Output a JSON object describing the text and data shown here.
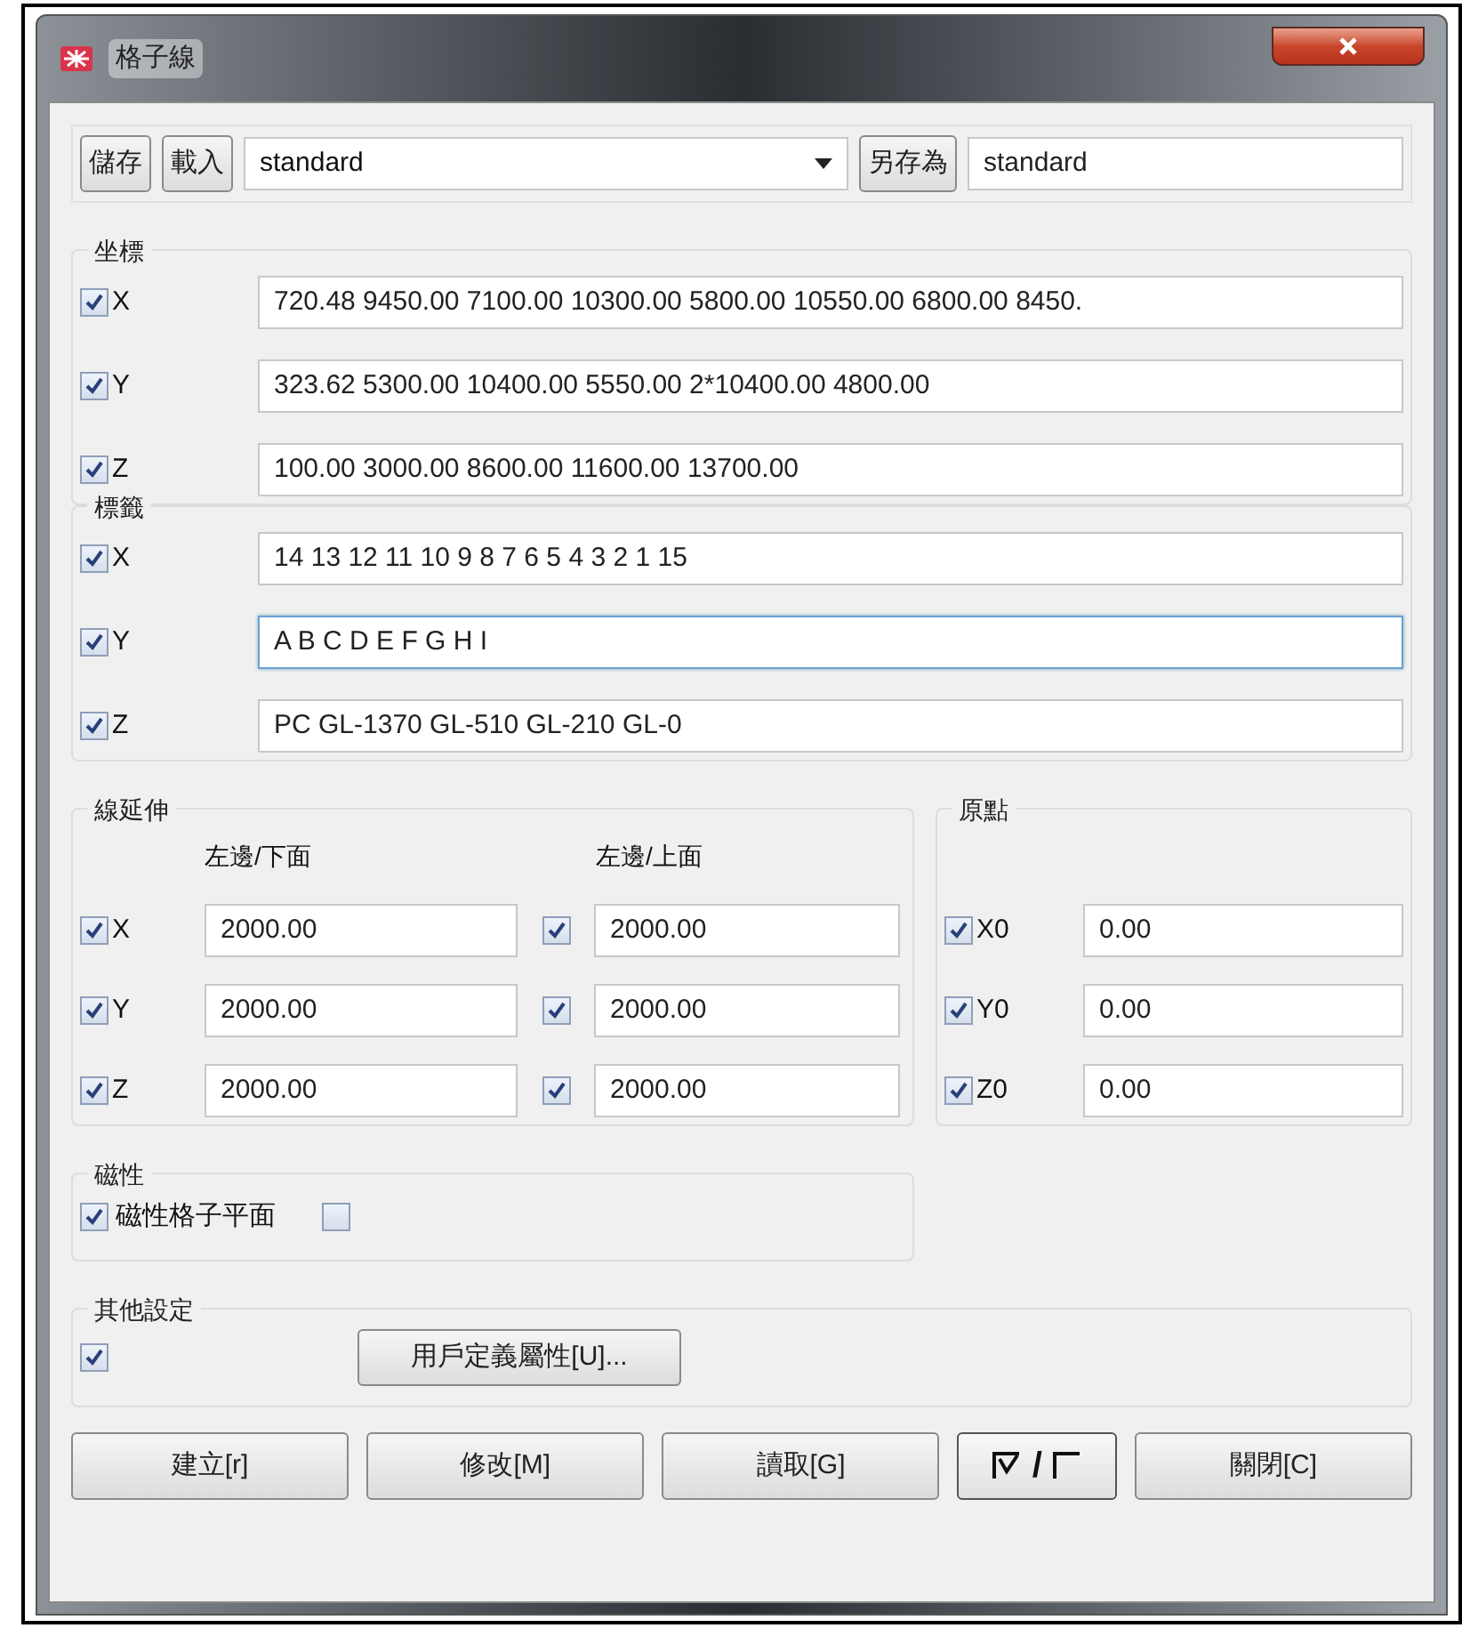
{
  "window": {
    "title": "格子線"
  },
  "toolbar": {
    "save": "儲存",
    "load": "載入",
    "preset": "standard",
    "save_as": "另存為",
    "save_as_name": "standard"
  },
  "coordinates": {
    "title": "坐標",
    "rows": [
      {
        "label": "X",
        "checked": true,
        "value": "720.48 9450.00 7100.00 10300.00 5800.00 10550.00 6800.00 8450.",
        "focused": false
      },
      {
        "label": "Y",
        "checked": true,
        "value": "323.62 5300.00 10400.00 5550.00 2*10400.00 4800.00",
        "focused": false
      },
      {
        "label": "Z",
        "checked": true,
        "value": "100.00 3000.00 8600.00 11600.00 13700.00",
        "focused": false
      }
    ]
  },
  "labels": {
    "title": "標籤",
    "rows": [
      {
        "label": "X",
        "checked": true,
        "value": "14 13 12 11 10 9 8 7 6 5 4 3 2 1 15",
        "focused": false
      },
      {
        "label": "Y",
        "checked": true,
        "value": "A B C D E F G H I",
        "focused": true
      },
      {
        "label": "Z",
        "checked": true,
        "value": "PC GL-1370 GL-510 GL-210 GL-0",
        "focused": false
      }
    ]
  },
  "extension": {
    "title": "線延伸",
    "lower_heading": "左邊/下面",
    "upper_heading": "左邊/上面",
    "rows": [
      {
        "label": "X",
        "lower_checked": true,
        "lower": "2000.00",
        "upper_checked": true,
        "upper": "2000.00"
      },
      {
        "label": "Y",
        "lower_checked": true,
        "lower": "2000.00",
        "upper_checked": true,
        "upper": "2000.00"
      },
      {
        "label": "Z",
        "lower_checked": true,
        "lower": "2000.00",
        "upper_checked": true,
        "upper": "2000.00"
      }
    ]
  },
  "origin": {
    "title": "原點",
    "rows": [
      {
        "label": "X0",
        "checked": true,
        "value": "0.00"
      },
      {
        "label": "Y0",
        "checked": true,
        "value": "0.00"
      },
      {
        "label": "Z0",
        "checked": true,
        "value": "0.00"
      }
    ]
  },
  "magnetic": {
    "title": "磁性",
    "label": "磁性格子平面",
    "checked": true,
    "second_checked": false
  },
  "other": {
    "title": "其他設定",
    "checked": true,
    "button": "用戶定義屬性[U]..."
  },
  "footer": [
    {
      "kind": "button",
      "label": "建立[r]"
    },
    {
      "kind": "button",
      "label": "修改[M]"
    },
    {
      "kind": "button",
      "label": "讀取[G]"
    },
    {
      "kind": "toggle",
      "label": "/"
    },
    {
      "kind": "button",
      "label": "關閉[C]"
    }
  ]
}
